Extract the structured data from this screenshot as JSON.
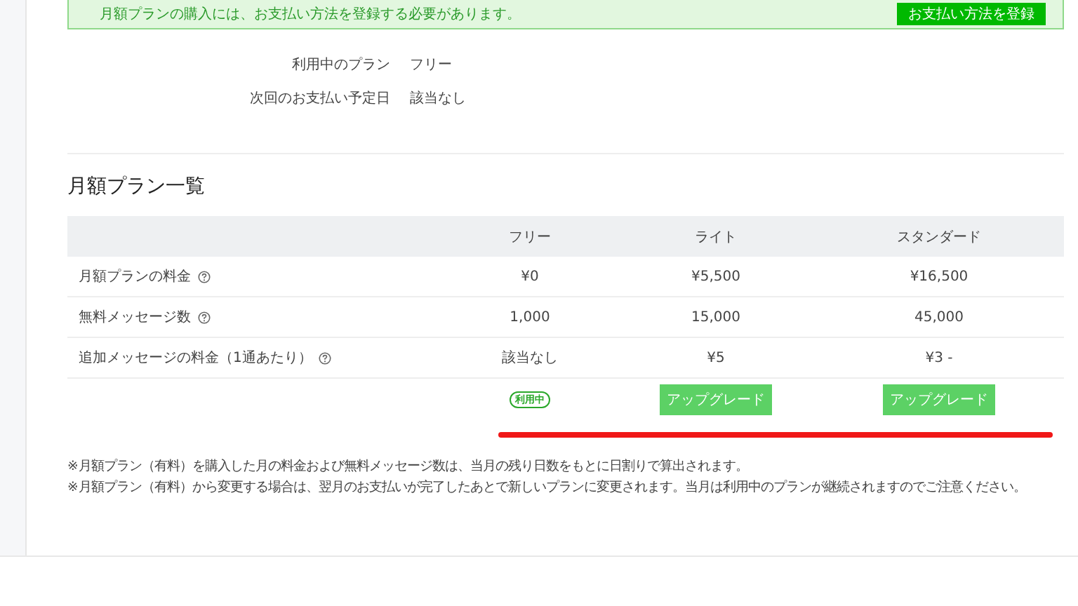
{
  "banner": {
    "message": "月額プランの購入には、お支払い方法を登録する必要があります。",
    "button": "お支払い方法を登録"
  },
  "plan_info": [
    {
      "label": "利用中のプラン",
      "value": "フリー"
    },
    {
      "label": "次回のお支払い予定日",
      "value": "該当なし"
    }
  ],
  "section_title": "月額プラン一覧",
  "table": {
    "columns": [
      "フリー",
      "ライト",
      "スタンダード"
    ],
    "rows": [
      {
        "label": "月額プランの料金",
        "help": true,
        "cells": [
          "¥0",
          "¥5,500",
          "¥16,500"
        ]
      },
      {
        "label": "無料メッセージ数",
        "help": true,
        "cells": [
          "1,000",
          "15,000",
          "45,000"
        ]
      },
      {
        "label": "追加メッセージの料金（1通あたり）",
        "help": true,
        "cells": [
          "該当なし",
          "¥5",
          "¥3 -"
        ]
      }
    ],
    "actions": [
      {
        "kind": "badge",
        "label": "利用中"
      },
      {
        "kind": "button",
        "label": "アップグレード"
      },
      {
        "kind": "button",
        "label": "アップグレード"
      }
    ]
  },
  "notes": [
    "※月額プラン（有料）を購入した月の料金および無料メッセージ数は、当月の残り日数をもとに日割りで算出されます。",
    "※月額プラン（有料）から変更する場合は、翌月のお支払いが完了したあとで新しいプランに変更されます。当月は利用中のプランが継続されますのでご注意ください。"
  ]
}
